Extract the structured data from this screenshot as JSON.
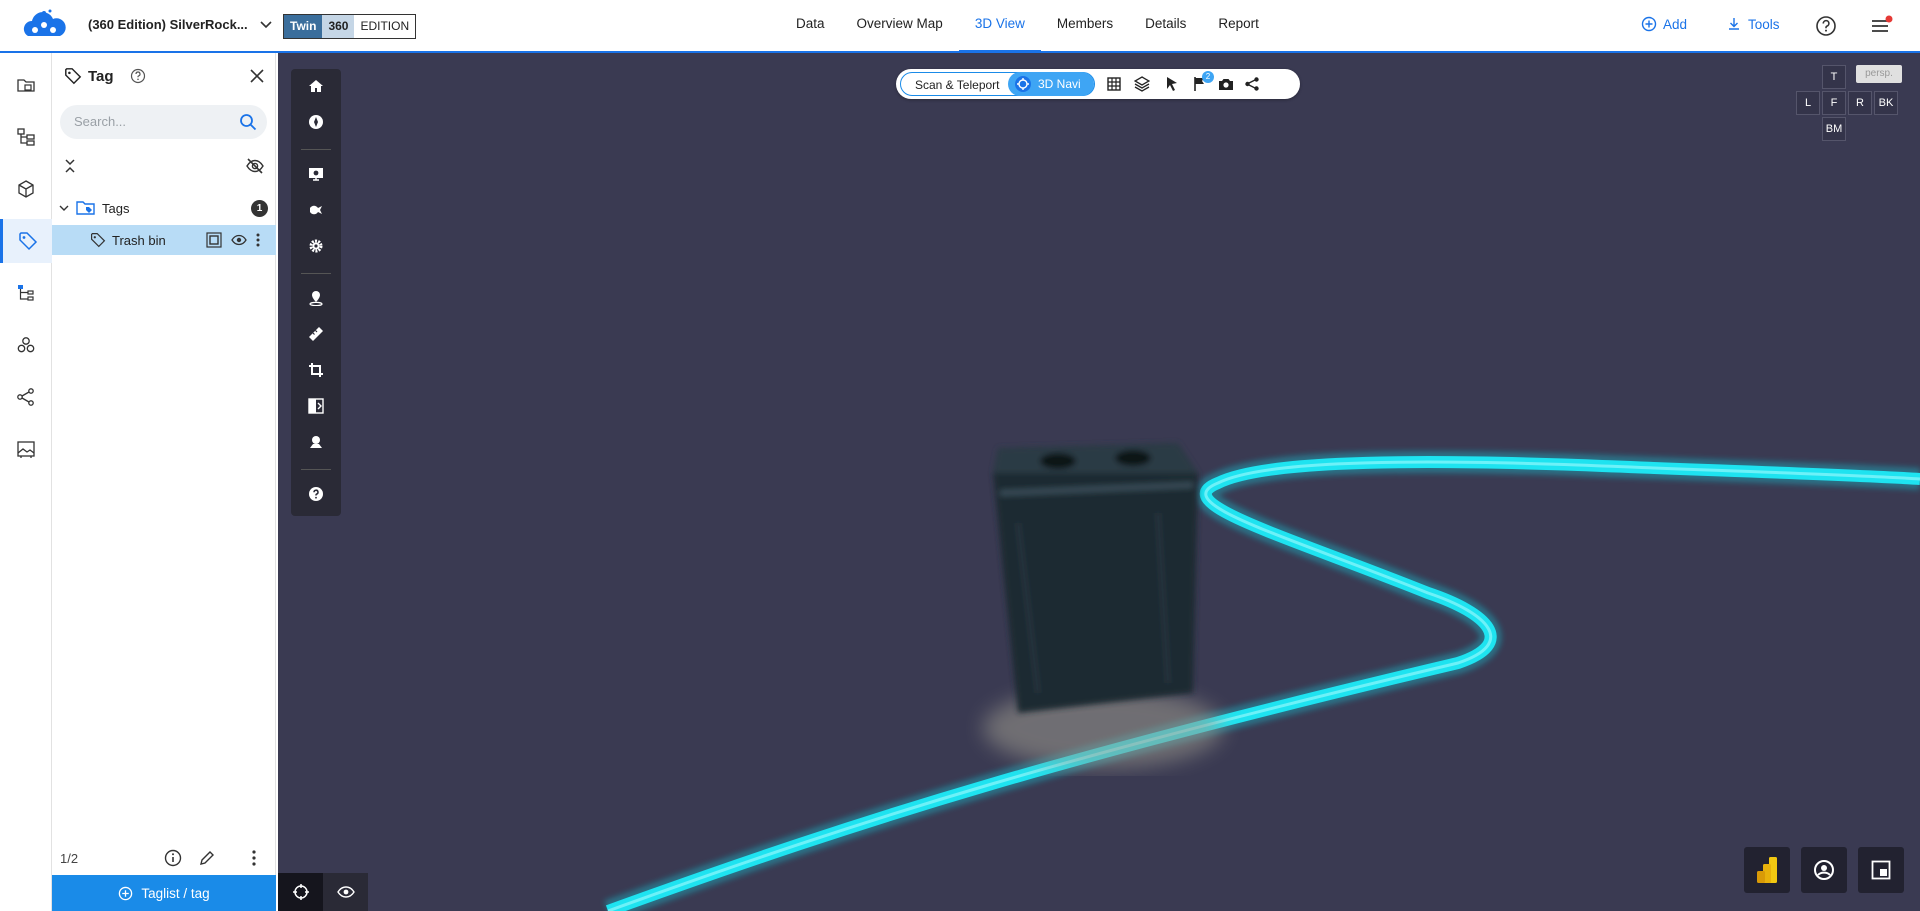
{
  "header": {
    "project_name": "(360 Edition) SilverRock...",
    "edition": {
      "twin": "Twin",
      "num": "360",
      "label": "EDITION"
    },
    "nav": [
      "Data",
      "Overview Map",
      "3D View",
      "Members",
      "Details",
      "Report"
    ],
    "active_tab": "3D View",
    "add_label": "Add",
    "tools_label": "Tools",
    "accent_color": "#1a73e8"
  },
  "rail": {
    "items": [
      "folders-icon",
      "hierarchy-icon",
      "cube-icon",
      "tag-icon",
      "tree-icon",
      "cluster-icon",
      "share-icon",
      "image-icon"
    ],
    "active": "tag-icon"
  },
  "tag_panel": {
    "title": "Tag",
    "search_placeholder": "Search...",
    "group_label": "Tags",
    "group_count": "1",
    "item_label": "Trash bin",
    "page_counter": "1/2",
    "add_button_label": "Taglist / tag"
  },
  "viewer": {
    "mode_scan": "Scan & Teleport",
    "mode_navi": "3D Navi",
    "flag_badge": "2",
    "cube_views": {
      "top": "T",
      "left": "L",
      "front": "F",
      "right": "R",
      "back": "BK",
      "bottom": "BM"
    },
    "projection": "persp.",
    "background_color": "#3a3a52",
    "path_color": "#1ee3f0"
  }
}
